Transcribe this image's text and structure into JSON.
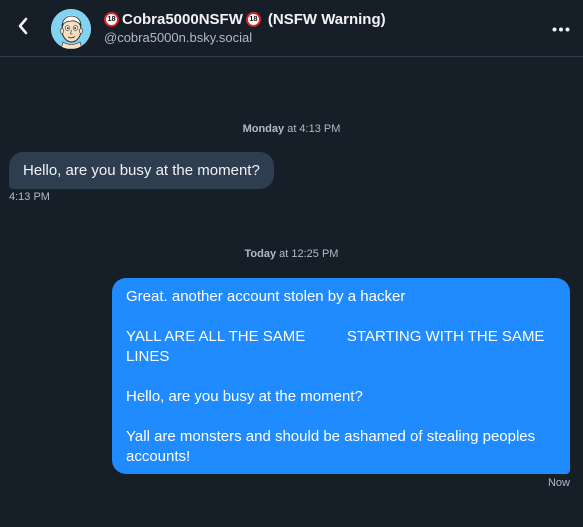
{
  "header": {
    "back_icon": "chevron-left-icon",
    "display_name": "Cobra5000NSFW",
    "age_badge_text": "18",
    "nsfw_label": "(NSFW Warning)",
    "handle": "@cobra5000n.bsky.social",
    "more_icon": "more-horizontal-icon"
  },
  "conversation": {
    "separators": [
      {
        "day": "Monday",
        "time": "at 4:13 PM"
      },
      {
        "day": "Today",
        "time": "at 12:25 PM"
      }
    ],
    "messages": [
      {
        "direction": "incoming",
        "paragraphs": [
          "Hello, are you busy at the moment?"
        ],
        "timestamp": "4:13 PM"
      },
      {
        "direction": "outgoing",
        "paragraphs": [
          "Great. another account stolen by a hacker",
          "YALL ARE ALL THE SAME          STARTING WITH THE SAME LINES",
          "Hello, are you busy at the moment?",
          "Yall are monsters and should be ashamed of stealing peoples accounts!"
        ],
        "timestamp": "Now"
      }
    ]
  },
  "colors": {
    "background": "#161e27",
    "incoming_bubble": "#2e3d4f",
    "outgoing_bubble": "#208bfe",
    "muted_text": "#aebbc9",
    "badge_red": "#d8232a"
  }
}
